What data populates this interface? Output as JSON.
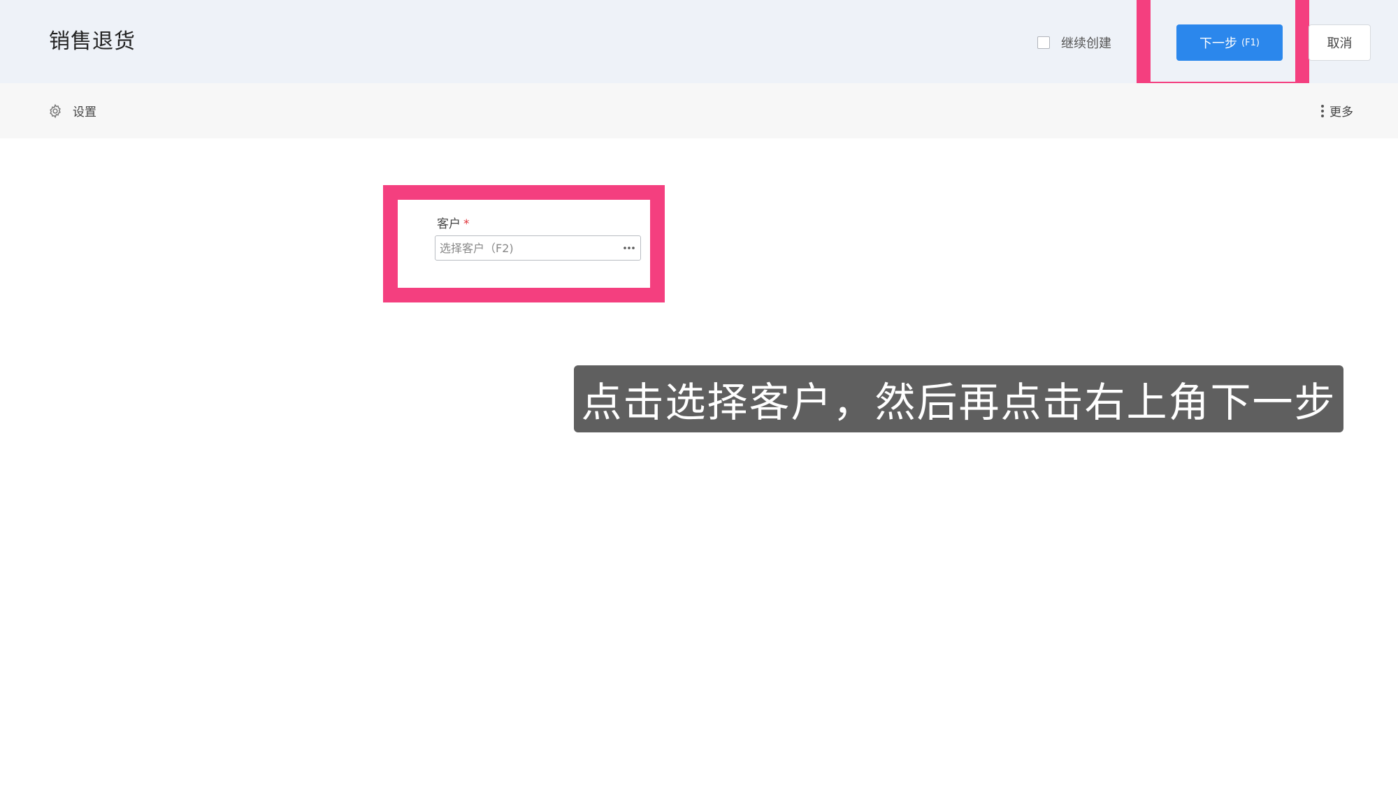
{
  "header": {
    "title": "销售退货",
    "continue_create_label": "继续创建",
    "continue_create_checked": false,
    "next_label": "下一步",
    "next_shortcut": "(F1)",
    "cancel_label": "取消",
    "primary_color": "#2b87ec"
  },
  "toolbar": {
    "settings_label": "设置",
    "settings_icon": "gear-icon",
    "more_label": "更多",
    "more_icon": "vertical-dots-icon"
  },
  "form": {
    "customer_label": "客户",
    "required_mark": "*",
    "customer_value": "",
    "customer_placeholder": "选择客户（F2)",
    "customer_picker_icon": "ellipsis-icon"
  },
  "annotations": {
    "highlight_color": "#f43f7f",
    "caption": "点击选择客户，然后再点击右上角下一步"
  }
}
